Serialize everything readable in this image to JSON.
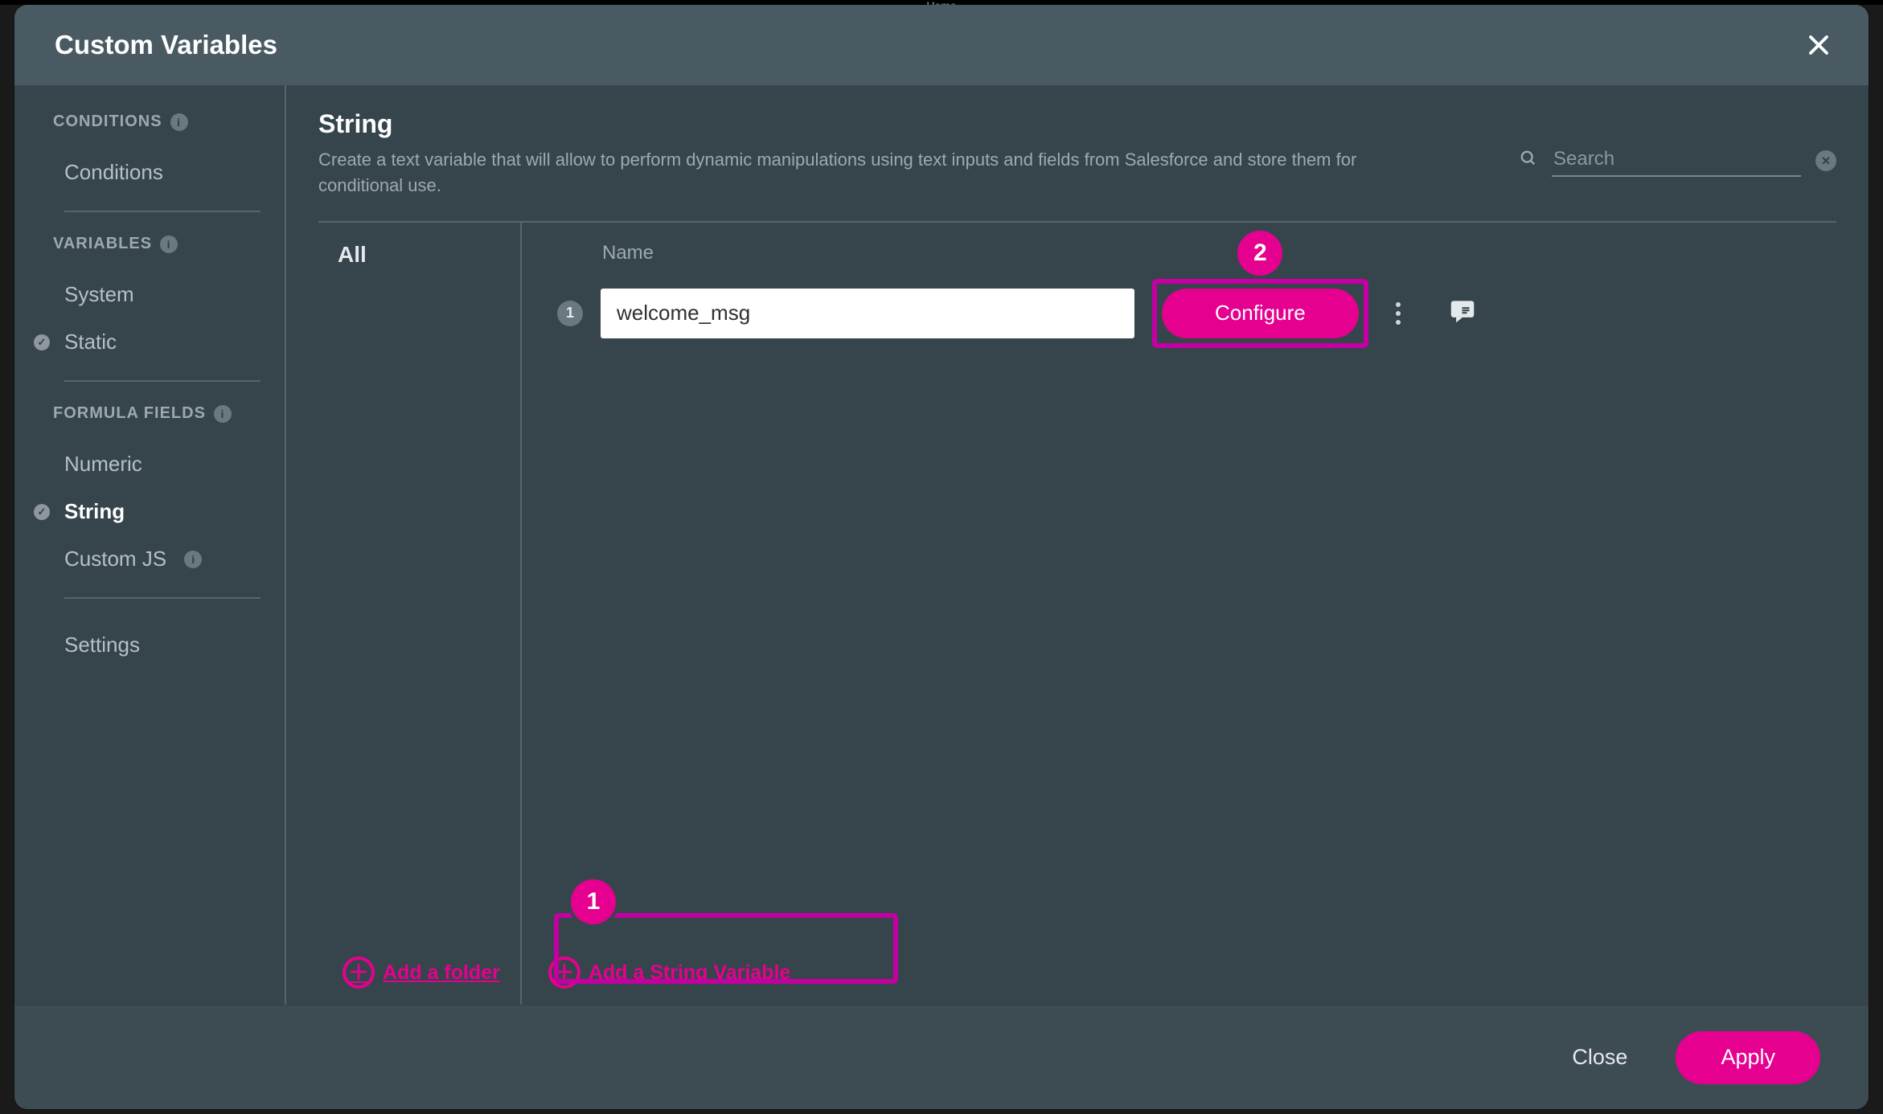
{
  "bg": {
    "tab": "Home"
  },
  "modal": {
    "title": "Custom Variables",
    "close": "Close",
    "apply": "Apply"
  },
  "sidebar": {
    "sections": {
      "conditions": {
        "head": "CONDITIONS",
        "items": [
          "Conditions"
        ]
      },
      "variables": {
        "head": "VARIABLES",
        "items": [
          "System",
          "Static"
        ],
        "checked_index": 1
      },
      "formula": {
        "head": "FORMULA FIELDS",
        "items": [
          "Numeric",
          "String",
          "Custom JS",
          "Settings"
        ],
        "active_index": 1,
        "info_index": 2
      }
    }
  },
  "main": {
    "title": "String",
    "description": "Create a text variable that will allow to perform dynamic manipulations using text inputs and fields from Salesforce and store them for conditional use.",
    "search_placeholder": "Search",
    "tabs": {
      "all": "All"
    },
    "name_label": "Name",
    "row": {
      "index": "1",
      "name_value": "welcome_msg",
      "configure": "Configure"
    },
    "add_folder": "Add a folder",
    "add_string": "Add a String Variable"
  },
  "callouts": {
    "one": "1",
    "two": "2"
  }
}
